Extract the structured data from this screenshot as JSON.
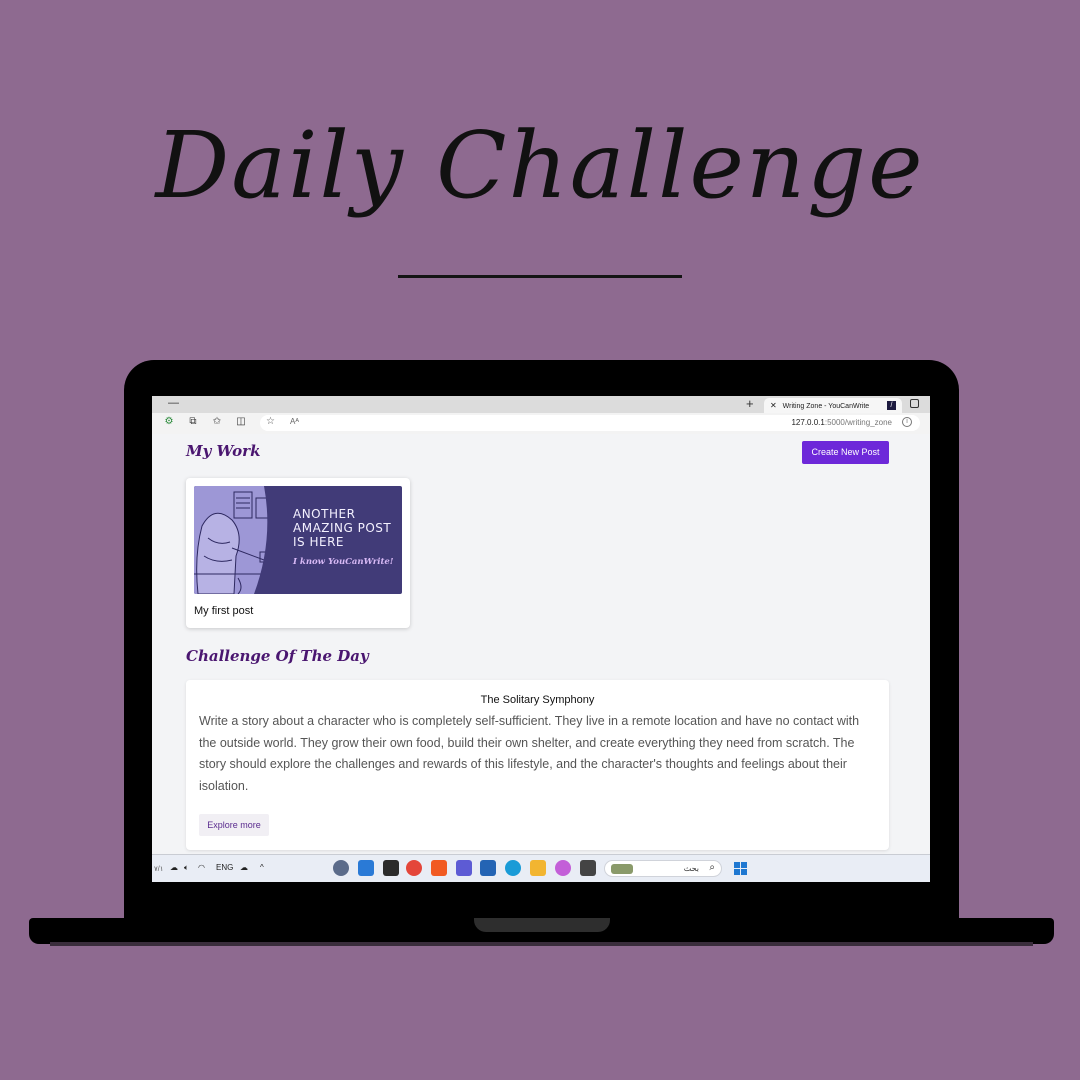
{
  "hero": {
    "title": "Daily Challenge"
  },
  "browser": {
    "tab_title": "Writing Zone - YouCanWrite",
    "tab_close": "✕",
    "new_tab": "+",
    "minimize": "—",
    "url_host": "127.0.0.1",
    "url_path": ":5000/writing_zone",
    "read_aloud": "Aᴬ"
  },
  "page": {
    "my_work_heading": "My Work",
    "create_button": "Create New Post",
    "posts": [
      {
        "title": "My first post",
        "thumb_lines": [
          "ANOTHER",
          "AMAZING POST",
          "IS HERE"
        ],
        "thumb_sub": "I know YouCanWrite!"
      }
    ],
    "challenge_heading": "Challenge Of The Day",
    "challenge": {
      "title": "The Solitary Symphony",
      "body": "Write a story about a character who is completely self-sufficient. They live in a remote location and have no contact with the outside world. They grow their own food, build their own shelter, and create everything they need from scratch. The story should explore the challenges and rewards of this lifestyle, and the character's thoughts and feelings about their isolation.",
      "explore_button": "Explore more"
    }
  },
  "taskbar": {
    "language": "ENG",
    "search_text": "بحث",
    "corner_text": "٧/١",
    "chevron": "^"
  },
  "colors": {
    "background": "#8e6a90",
    "heading": "#4a1670",
    "primary_button": "#6d28d9",
    "thumb_bg": "#413b78"
  }
}
